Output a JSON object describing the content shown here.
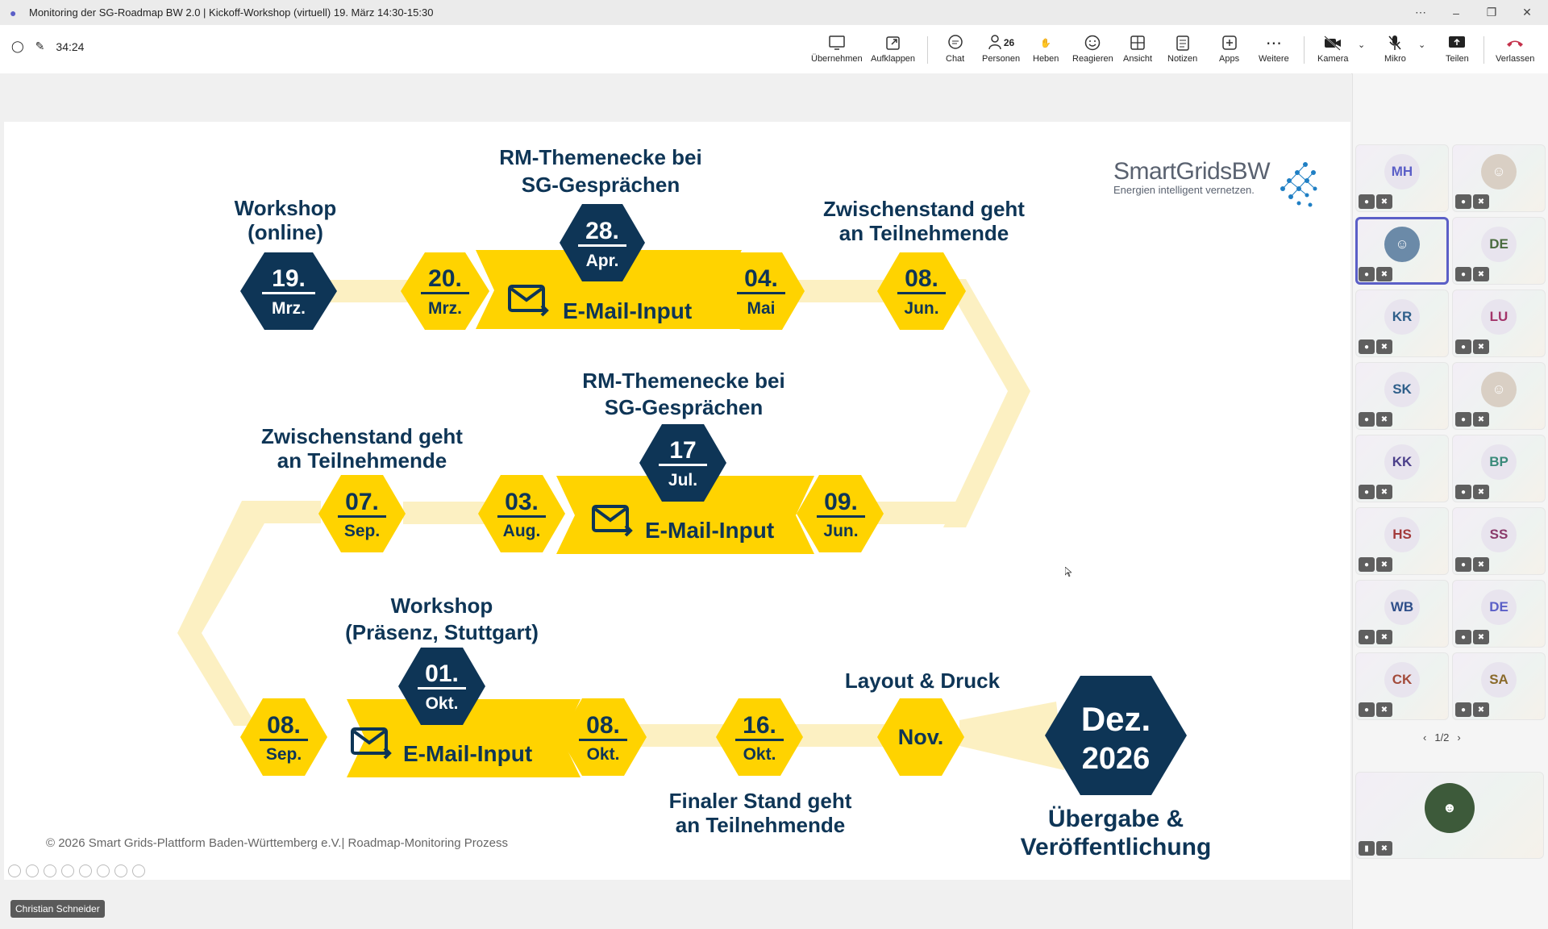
{
  "window": {
    "title": "Monitoring der SG-Roadmap BW 2.0 | Kickoff-Workshop (virtuell) 19. März 14:30-15:30"
  },
  "toolbar": {
    "timer": "34:24",
    "buttons": {
      "uebernehmen": "Übernehmen",
      "aufklappen": "Aufklappen",
      "chat": "Chat",
      "personen": "Personen",
      "personen_count": "26",
      "heben": "Heben",
      "reagieren": "Reagieren",
      "ansicht": "Ansicht",
      "notizen": "Notizen",
      "apps": "Apps",
      "weitere": "Weitere",
      "kamera": "Kamera",
      "mikro": "Mikro",
      "teilen": "Teilen",
      "verlassen": "Verlassen"
    }
  },
  "slide": {
    "logo_main": "SmartGridsBW",
    "logo_sub": "Energien intelligent vernetzen.",
    "footer": "© 2026 Smart Grids-Plattform Baden-Württemberg e.V.| Roadmap-Monitoring Prozess",
    "nodes": [
      {
        "day": "19.",
        "month": "Mrz."
      },
      {
        "day": "20.",
        "month": "Mrz."
      },
      {
        "day": "28.",
        "month": "Apr."
      },
      {
        "day": "04.",
        "month": "Mai"
      },
      {
        "day": "08.",
        "month": "Jun."
      },
      {
        "day": "09.",
        "month": "Jun."
      },
      {
        "day": "17",
        "month": "Jul."
      },
      {
        "day": "03.",
        "month": "Aug."
      },
      {
        "day": "07.",
        "month": "Sep."
      },
      {
        "day": "08.",
        "month": "Sep."
      },
      {
        "day": "01.",
        "month": "Okt."
      },
      {
        "day": "08.",
        "month": "Okt."
      },
      {
        "day": "16.",
        "month": "Okt."
      },
      {
        "label": "Nov."
      },
      {
        "line1": "Dez.",
        "line2": "2026"
      }
    ],
    "email_input": "E-Mail-Input",
    "labels": {
      "workshop_online_1": "Workshop",
      "workshop_online_2": "(online)",
      "rm_1": "RM-Themenecke bei",
      "rm_2": "SG-Gesprächen",
      "zw_1": "Zwischenstand geht",
      "zw_2": "an Teilnehmende",
      "workshop_praesenz_1": "Workshop",
      "workshop_praesenz_2": "(Präsenz, Stuttgart)",
      "layout": "Layout & Druck",
      "final_1": "Finaler Stand geht",
      "final_2": "an Teilnehmende",
      "uebergabe_1": "Übergabe &",
      "uebergabe_2": "Veröffentlichung"
    }
  },
  "gallery": {
    "tiles": [
      {
        "initials": "MH",
        "color": "#5b5fc7"
      },
      {
        "initials": "",
        "photo": true
      },
      {
        "initials": "",
        "photo": true,
        "active": true
      },
      {
        "initials": "DE",
        "color": "#4a6b3f"
      },
      {
        "initials": "KR",
        "color": "#2f5f8a"
      },
      {
        "initials": "LU",
        "color": "#a3346a"
      },
      {
        "initials": "SK",
        "color": "#2f5f8a"
      },
      {
        "initials": "",
        "photo": true
      },
      {
        "initials": "KK",
        "color": "#4b3f8a"
      },
      {
        "initials": "BP",
        "color": "#3a8a7a"
      },
      {
        "initials": "HS",
        "color": "#a33a3a"
      },
      {
        "initials": "SS",
        "color": "#8a3a6a"
      },
      {
        "initials": "WB",
        "color": "#2f4f8a"
      },
      {
        "initials": "DE",
        "color": "#5b5fc7"
      },
      {
        "initials": "CK",
        "color": "#a34a3a"
      },
      {
        "initials": "SA",
        "color": "#8a6a2a"
      }
    ],
    "page": "1/2",
    "presenter": "Christian Schneider"
  }
}
